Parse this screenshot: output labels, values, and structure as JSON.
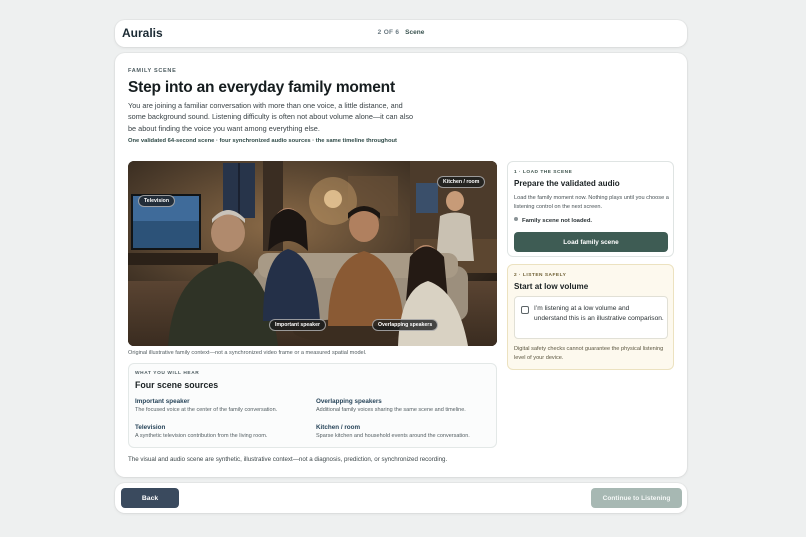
{
  "app": {
    "brand": "Auralis"
  },
  "progress": {
    "step_count": "2 OF 6",
    "step_name": "Scene"
  },
  "scene": {
    "eyebrow": "FAMILY SCENE",
    "title": "Step into an everyday family moment",
    "intro": "You are joining a familiar conversation with more than one voice, a little distance, and some background sound. Listening difficulty is often not about volume alone—it can also be about finding the voice you want among everything else.",
    "summary": "One validated 64-second scene · four synchronized audio sources · the same timeline throughout",
    "image_tags": {
      "television": "Television",
      "kitchen": "Kitchen / room",
      "important": "Important speaker",
      "overlapping": "Overlapping speakers"
    },
    "caption": "Original illustrative family context—not a synchronized video frame or a measured spatial model.",
    "sources": {
      "eyebrow": "WHAT YOU WILL HEAR",
      "title": "Four scene sources",
      "items": [
        {
          "name": "Important speaker",
          "desc": "The focused voice at the center of the family conversation."
        },
        {
          "name": "Overlapping speakers",
          "desc": "Additional family voices sharing the same scene and timeline."
        },
        {
          "name": "Television",
          "desc": "A synthetic television contribution from the living room."
        },
        {
          "name": "Kitchen / room",
          "desc": "Sparse kitchen and household events around the conversation."
        }
      ]
    },
    "disclaimer": "The visual and audio scene are synthetic, illustrative context—not a diagnosis, prediction, or synchronized recording."
  },
  "load_panel": {
    "label": "1 · LOAD THE SCENE",
    "title": "Prepare the validated audio",
    "desc": "Load the family moment now. Nothing plays until you choose a listening control on the next screen.",
    "status": "Family scene not loaded.",
    "button": "Load family scene"
  },
  "safety_panel": {
    "label": "2 · LISTEN SAFELY",
    "title": "Start at low volume",
    "checkbox": "I’m listening at a low volume and understand this is an illustrative comparison.",
    "note": "Digital safety checks cannot guarantee the physical listening level of your device."
  },
  "footer": {
    "back": "Back",
    "next": "Continue to Listening"
  },
  "colors": {
    "primary": "#3e5c54",
    "back": "#3a4a5e",
    "disabled": "#a7b8b3",
    "warning_bg": "#fdf9ee"
  }
}
